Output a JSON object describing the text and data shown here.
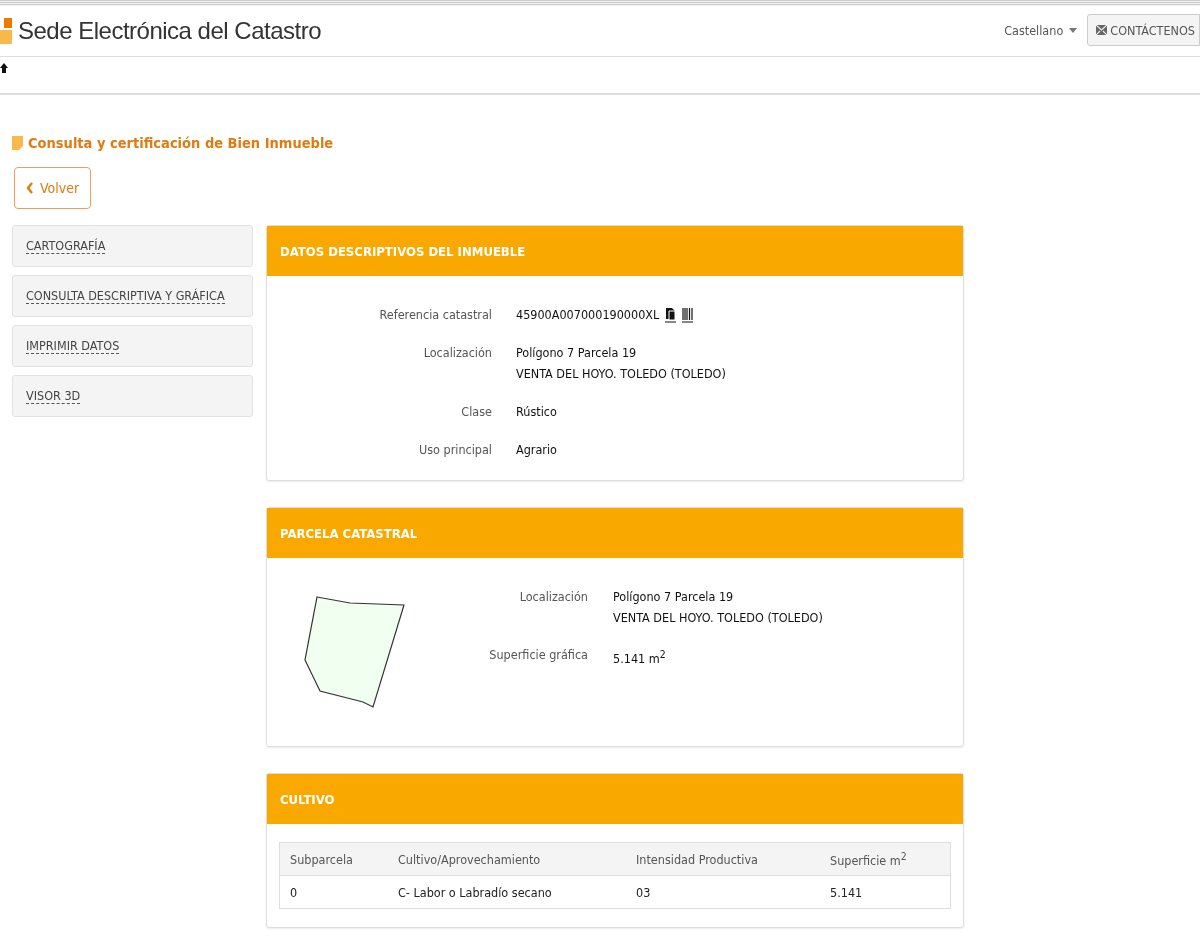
{
  "header": {
    "site_title": "Sede Electrónica del Catastro",
    "language": "Castellano",
    "contact_button": "CONTÁCTENOS"
  },
  "page_title": "Consulta y certificación de Bien Inmueble",
  "back_button": "Volver",
  "sidebar": {
    "items": [
      {
        "label": "CARTOGRAFÍA"
      },
      {
        "label": "CONSULTA DESCRIPTIVA Y GRÁFICA"
      },
      {
        "label": "IMPRIMIR DATOS"
      },
      {
        "label": "VISOR 3D"
      }
    ]
  },
  "datos": {
    "title": "DATOS DESCRIPTIVOS DEL INMUEBLE",
    "fields": [
      {
        "label": "Referencia catastral",
        "lines": [
          "45900A007000190000XL"
        ],
        "kind": "reference"
      },
      {
        "label": "Localización",
        "lines": [
          "Polígono 7 Parcela 19",
          "VENTA DEL HOYO. TOLEDO (TOLEDO)"
        ],
        "kind": "text"
      },
      {
        "label": "Clase",
        "lines": [
          "Rústico"
        ],
        "kind": "text"
      },
      {
        "label": "Uso principal",
        "lines": [
          "Agrario"
        ],
        "kind": "text"
      }
    ]
  },
  "parcela": {
    "title": "PARCELA CATASTRAL",
    "fields": [
      {
        "label": "Localización",
        "lines": [
          "Polígono 7 Parcela 19",
          "VENTA DEL HOYO. TOLEDO (TOLEDO)"
        ]
      },
      {
        "label": "Superficie gráfica",
        "lines": [
          "5.141 m$^{2}$"
        ]
      }
    ]
  },
  "cultivo": {
    "title": "CULTIVO",
    "table": {
      "columns": [
        "Subparcela",
        "Cultivo/Aprovechamiento",
        "Intensidad Productiva",
        "Superficie m$^{2}$"
      ],
      "rows": [
        [
          "0",
          "C- Labor o Labradío secano",
          "03",
          "5.141"
        ]
      ]
    }
  }
}
